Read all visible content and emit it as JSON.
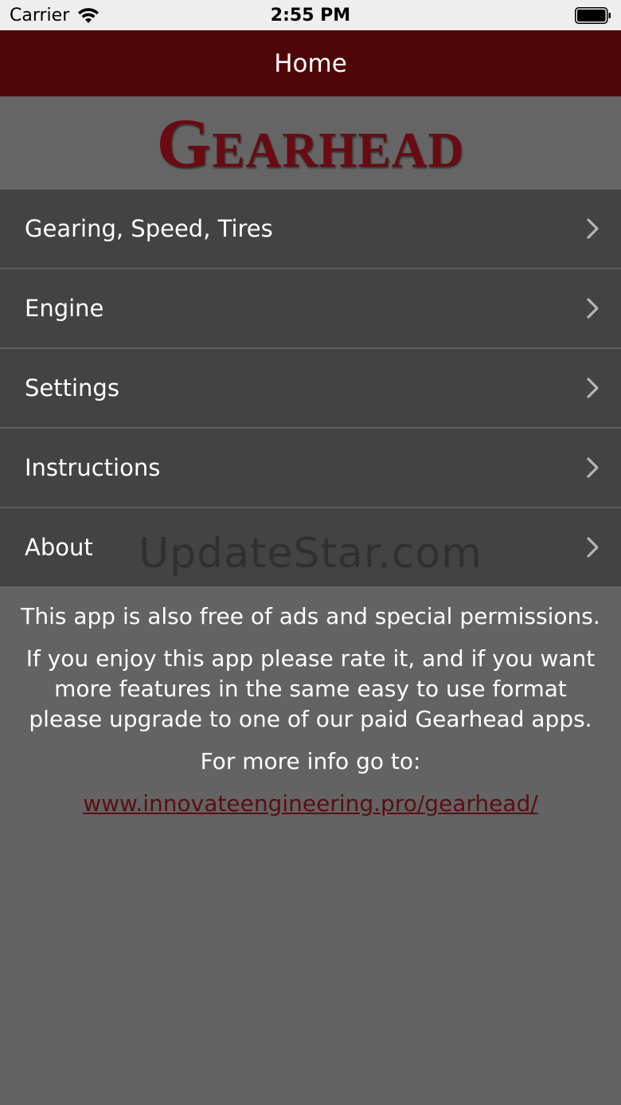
{
  "status_bar": {
    "carrier": "Carrier",
    "time": "2:55 PM"
  },
  "nav": {
    "title": "Home"
  },
  "logo": {
    "text": "Gearhead",
    "color": "#6a0a12"
  },
  "menu": {
    "items": [
      {
        "label": "Gearing, Speed, Tires"
      },
      {
        "label": "Engine"
      },
      {
        "label": "Settings"
      },
      {
        "label": "Instructions"
      },
      {
        "label": "About"
      }
    ]
  },
  "watermark": "UpdateStar.com",
  "info": {
    "line1": "This app is also free of ads and special permissions.",
    "line2": "If you enjoy this app please rate it, and if you want more features in the same easy to use format please upgrade to one of our paid Gearhead apps.",
    "line3": "For more info go to:",
    "link": "www.innovateengineering.pro/gearhead/"
  },
  "colors": {
    "nav_bar": "#4e0709",
    "menu_bg": "#434343",
    "page_bg": "#636363",
    "link": "#5a0e14"
  }
}
